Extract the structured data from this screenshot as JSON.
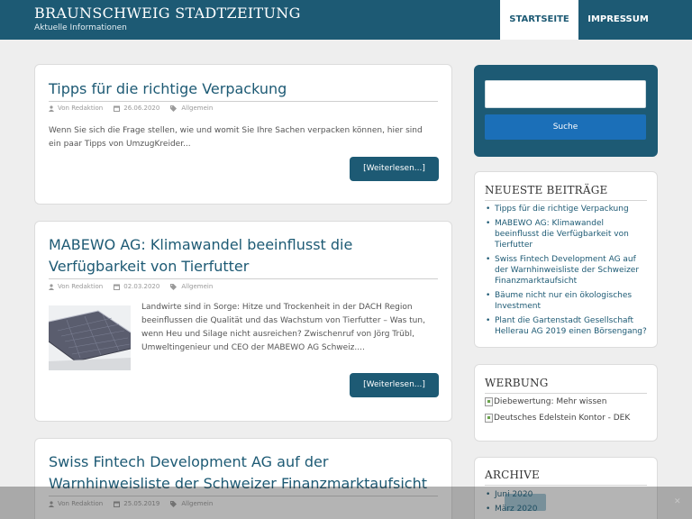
{
  "header": {
    "title": "BRAUNSCHWEIG STADTZEITUNG",
    "tagline": "Aktuelle Informationen",
    "nav": [
      "STARTSEITE",
      "IMPRESSUM"
    ]
  },
  "posts": [
    {
      "title": "Tipps für die richtige Verpackung",
      "author": "Von Redaktion",
      "date": "26.06.2020",
      "category": "Allgemein",
      "excerpt": "Wenn Sie sich die Frage stellen, wie und womit Sie Ihre Sachen verpacken können, hier sind ein paar Tipps von UmzugKreider...",
      "more": "[Weiterlesen...]"
    },
    {
      "title": "MABEWO AG: Klimawandel beeinflusst die Verfügbarkeit von Tierfutter",
      "author": "Von Redaktion",
      "date": "02.03.2020",
      "category": "Allgemein",
      "excerpt": "Landwirte sind in Sorge: Hitze und Trockenheit in der DACH Region beeinflussen die Qualität und das Wachstum von Tierfutter – Was tun, wenn Heu und Silage nicht ausreichen? Zwischenruf von Jörg Trübl, Umweltingenieur und CEO der MABEWO AG Schweiz....",
      "more": "[Weiterlesen...]",
      "image": "solar-panels-thumbnail"
    },
    {
      "title": "Swiss Fintech Development AG auf der Warnhinweisliste der Schweizer Finanzmarktaufsicht",
      "author": "Von Redaktion",
      "date": "25.05.2019",
      "category": "Allgemein"
    }
  ],
  "sidebar": {
    "search": {
      "placeholder": "",
      "button": "Suche"
    },
    "recent": {
      "title": "NEUESTE BEITRÄGE",
      "items": [
        "Tipps für die richtige Verpackung",
        "MABEWO AG: Klimawandel beeinflusst die Verfügbarkeit von Tierfutter",
        "Swiss Fintech Development AG auf der Warnhinweisliste der Schweizer Finanzmarktaufsicht",
        "Bäume nicht nur ein ökologisches Investment",
        "Plant die Gartenstadt Gesellschaft Hellerau AG 2019 einen Börsengang?"
      ]
    },
    "ads": {
      "title": "WERBUNG",
      "items": [
        "Diebewertung: Mehr wissen",
        "Deutsches Edelstein Kontor - DEK"
      ]
    },
    "archive": {
      "title": "ARCHIVE",
      "items": [
        "Juni 2020",
        "März 2020"
      ]
    }
  },
  "colors": {
    "brand": "#1d5a74",
    "search_button": "#1b6fb8",
    "background": "#eeeeee"
  },
  "icons": [
    "user-icon",
    "calendar-icon",
    "tags-icon",
    "close-icon"
  ]
}
